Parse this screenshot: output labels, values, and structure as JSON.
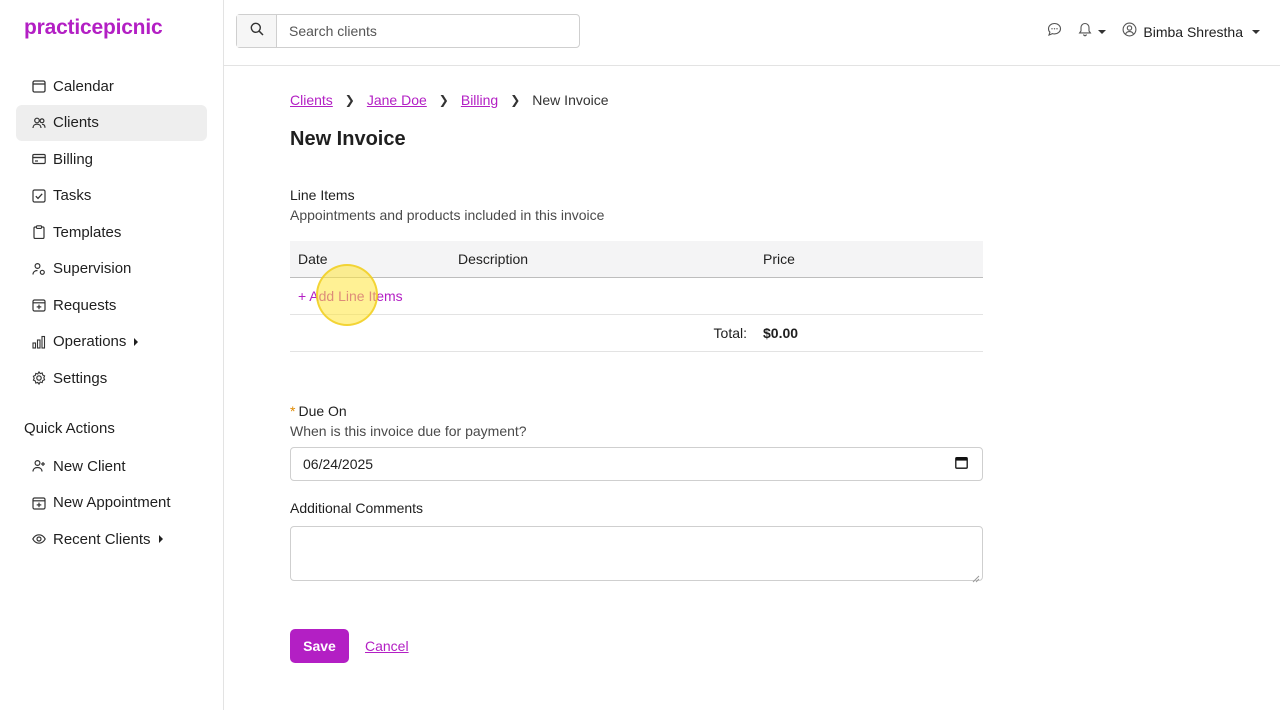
{
  "app": {
    "logo": "practicepicnic",
    "brand_color": "#b31fc4"
  },
  "sidebar": {
    "items": [
      {
        "label": "Calendar",
        "icon": "calendar-icon"
      },
      {
        "label": "Clients",
        "icon": "users-icon",
        "active": true
      },
      {
        "label": "Billing",
        "icon": "credit-card-icon"
      },
      {
        "label": "Tasks",
        "icon": "checkbox-icon"
      },
      {
        "label": "Templates",
        "icon": "clipboard-icon"
      },
      {
        "label": "Supervision",
        "icon": "user-gear-icon"
      },
      {
        "label": "Requests",
        "icon": "calendar-plus-icon"
      },
      {
        "label": "Operations",
        "icon": "bar-chart-icon",
        "has_submenu": true
      },
      {
        "label": "Settings",
        "icon": "gear-icon"
      }
    ],
    "quick_actions_title": "Quick Actions",
    "quick_actions": [
      {
        "label": "New Client",
        "icon": "user-plus-icon"
      },
      {
        "label": "New Appointment",
        "icon": "calendar-plus-icon"
      },
      {
        "label": "Recent Clients",
        "icon": "eye-icon",
        "has_submenu": true
      }
    ]
  },
  "header": {
    "search_placeholder": "Search clients",
    "user_name": "Bimba Shrestha"
  },
  "breadcrumb": {
    "clients": "Clients",
    "client_name": "Jane Doe",
    "billing": "Billing",
    "current": "New Invoice"
  },
  "page": {
    "title": "New Invoice",
    "line_items": {
      "title": "Line Items",
      "subtitle": "Appointments and products included in this invoice",
      "columns": {
        "date": "Date",
        "description": "Description",
        "price": "Price"
      },
      "add_label": "+ Add Line Items",
      "total_label": "Total:",
      "total_value": "$0.00"
    },
    "due_on": {
      "required_mark": "*",
      "label": "Due On",
      "help": "When is this invoice due for payment?",
      "value": "06/24/2025"
    },
    "comments": {
      "label": "Additional Comments",
      "value": ""
    },
    "save_label": "Save",
    "cancel_label": "Cancel"
  }
}
